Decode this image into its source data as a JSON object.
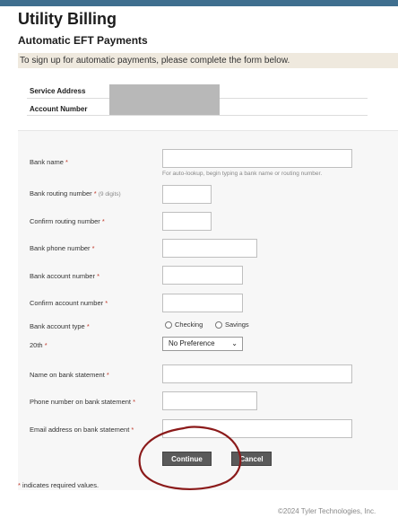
{
  "header": {
    "title": "Utility Billing",
    "subtitle": "Automatic EFT Payments",
    "instructions": "To sign up for automatic payments, please complete the form below."
  },
  "account_info": {
    "service_address_label": "Service Address",
    "account_number_label": "Account Number"
  },
  "form": {
    "bank_name": {
      "label": "Bank name",
      "help": "For auto-lookup, begin typing a bank name or routing number."
    },
    "routing": {
      "label": "Bank routing number",
      "hint": "(9 digits)"
    },
    "confirm_routing": {
      "label": "Confirm routing number"
    },
    "bank_phone": {
      "label": "Bank phone number"
    },
    "account_number": {
      "label": "Bank account number"
    },
    "confirm_account": {
      "label": "Confirm account number"
    },
    "account_type": {
      "label": "Bank account type",
      "options": [
        "Checking",
        "Savings"
      ]
    },
    "draft_day": {
      "label": "20th",
      "selected": "No Preference"
    },
    "name_on_statement": {
      "label": "Name on bank statement"
    },
    "phone_on_statement": {
      "label": "Phone number on bank statement"
    },
    "email_on_statement": {
      "label": "Email address on bank statement"
    },
    "required_marker": "*"
  },
  "actions": {
    "continue_label": "Continue",
    "cancel_label": "Cancel"
  },
  "required_note": "indicates required values.",
  "footer": "©2024 Tyler Technologies, Inc.",
  "colors": {
    "header_bar": "#3f6f8f",
    "instructions_bg": "#efe9de",
    "required": "#c0392b",
    "button": "#5a5a5a",
    "annotation_circle": "#8b1a1a"
  }
}
